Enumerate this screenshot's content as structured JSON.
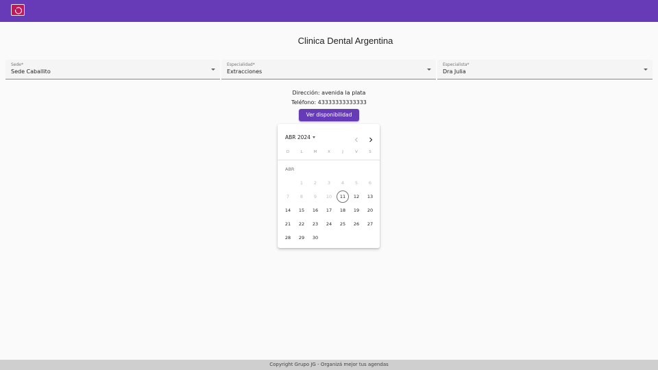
{
  "colors": {
    "primary": "#673ab7",
    "logo": "#c2185b"
  },
  "header": {
    "logo_icon": "logo-icon"
  },
  "page": {
    "title": "Clinica Dental Argentina"
  },
  "filters": {
    "sede": {
      "label": "Sede*",
      "value": "Sede Caballito"
    },
    "especialidad": {
      "label": "Especialidad*",
      "value": "Extracciones"
    },
    "especialista": {
      "label": "Especialista*",
      "value": "Dra Julia"
    }
  },
  "info": {
    "direccion": "Dirección: avenida la plata",
    "telefono": "Teléfono: 43333333333333"
  },
  "actions": {
    "ver_disponibilidad": "Ver disponibilidad"
  },
  "calendar": {
    "period_label": "ABR 2024",
    "month_label": "ABR",
    "weekdays": [
      "D",
      "L",
      "M",
      "X",
      "J",
      "V",
      "S"
    ],
    "today": "11",
    "weeks": [
      [
        "",
        "1",
        "2",
        "3",
        "4",
        "5",
        "6"
      ],
      [
        "7",
        "8",
        "9",
        "10",
        "11",
        "12",
        "13"
      ],
      [
        "14",
        "15",
        "16",
        "17",
        "18",
        "19",
        "20"
      ],
      [
        "21",
        "22",
        "23",
        "24",
        "25",
        "26",
        "27"
      ],
      [
        "28",
        "29",
        "30",
        "",
        "",
        "",
        ""
      ]
    ],
    "disabled_days": [
      "1",
      "2",
      "3",
      "4",
      "5",
      "6",
      "7",
      "8",
      "9",
      "10"
    ]
  },
  "footer": {
    "text": "Copyright Grupo JG - Organizá mejor tus agendas"
  }
}
